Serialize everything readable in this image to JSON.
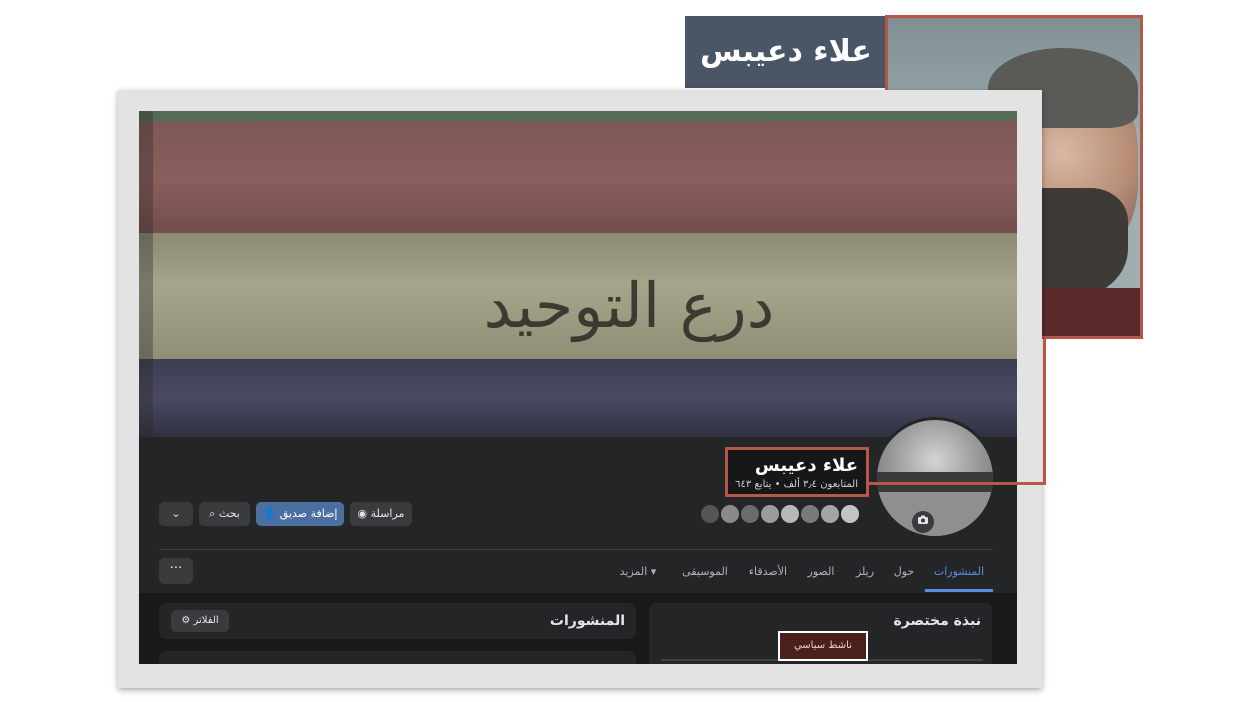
{
  "callout": {
    "name": "علاء دعيبس"
  },
  "cover": {
    "flag_text": "درع التوحيد"
  },
  "profile": {
    "name": "علاء دعيبس",
    "followers_line": "المتابعون ٣٫٤ ألف • يتابع ٦٤٣",
    "badge_icon": "camera-icon"
  },
  "actions": {
    "message_label": "مراسلة",
    "add_friend_label": "إضافة صديق",
    "search_label": "بحث",
    "dropdown_icon": "chevron-down-icon"
  },
  "tabs": [
    {
      "label": "المنشورات",
      "active": true
    },
    {
      "label": "حول",
      "active": false
    },
    {
      "label": "ريلز",
      "active": false
    },
    {
      "label": "الصور",
      "active": false
    },
    {
      "label": "الأصدقاء",
      "active": false
    },
    {
      "label": "الموسيقى",
      "active": false
    },
    {
      "label": "المزيد ▾",
      "active": false
    }
  ],
  "more_label": "···",
  "intro": {
    "title": "نبذة مختصرة",
    "bio": "ناشط سياسي"
  },
  "posts": {
    "title": "المنشورات",
    "filters_label": "الفلاتر"
  },
  "colors": {
    "highlight": "#b5584a",
    "accent": "#5a8ee0",
    "banner": "#4a5566"
  }
}
